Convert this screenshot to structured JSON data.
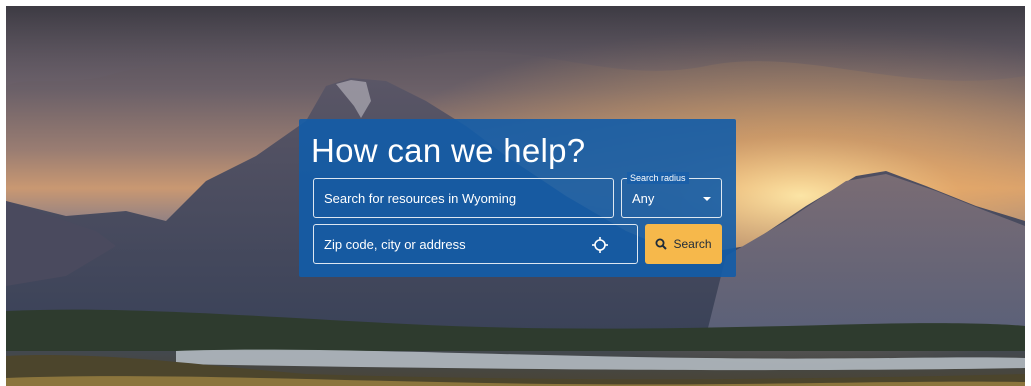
{
  "hero": {
    "background_image": "mountain-landscape"
  },
  "search_panel": {
    "title": "How can we help?",
    "resource_placeholder": "Search for resources in Wyoming",
    "radius_label": "Search radius",
    "radius_value": "Any",
    "location_placeholder": "Zip code, city or address",
    "locate_icon": "crosshair-icon",
    "search_button_label": "Search",
    "search_icon": "search-icon",
    "colors": {
      "panel": "#125ca8",
      "button": "#f6b84b",
      "text": "#ffffff"
    }
  }
}
